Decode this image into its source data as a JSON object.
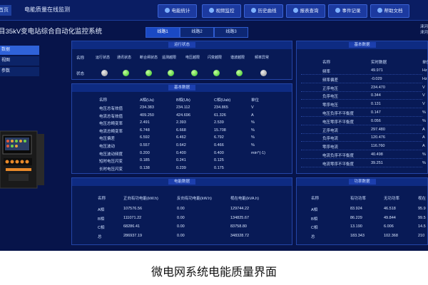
{
  "topbar": {
    "home_label": "首页",
    "system_title": "电能质量在线监测",
    "nav": [
      {
        "label": "电能统计",
        "icon": "chart-icon"
      },
      {
        "label": "视频监控",
        "icon": "video-icon"
      },
      {
        "label": "历史曲线",
        "icon": "curve-icon"
      },
      {
        "label": "报表查询",
        "icon": "report-icon"
      },
      {
        "label": "事件记录",
        "icon": "event-icon"
      },
      {
        "label": "帮助文档",
        "icon": "help-icon"
      }
    ]
  },
  "page": {
    "title": "目35kV变电站综合自动化监控系统",
    "line_tabs": [
      "线路1",
      "线路2",
      "线路3"
    ],
    "active_tab": 0,
    "user_line1": "涞河",
    "user_line2": "涞河"
  },
  "sidebar": {
    "items": [
      {
        "label": "数据",
        "active": true
      },
      {
        "label": "视图",
        "active": false
      },
      {
        "label": "参数",
        "active": false
      }
    ]
  },
  "run_status": {
    "title": "运行状态",
    "name_header": "名称",
    "row_label": "状态",
    "columns": [
      "运行状态",
      "通讯状态",
      "断合闸状态",
      "遥测越限",
      "电压越限",
      "闪变越限",
      "谐波越限",
      "频率异常"
    ],
    "states": [
      "off",
      "on",
      "on",
      "on",
      "on",
      "on",
      "on",
      "off"
    ]
  },
  "basic_data": {
    "title": "基本数据",
    "headers": [
      "名称",
      "A相(Ua)",
      "B相(Ub)",
      "C相(Uab)",
      "单位"
    ],
    "rows": [
      [
        "电压总有效值",
        "234.383",
        "234.112",
        "234.865",
        "V"
      ],
      [
        "电流总有效值",
        "409.250",
        "424.696",
        "61.326",
        "A"
      ],
      [
        "电压总畸变率",
        "2.491",
        "2.393",
        "2.539",
        "%"
      ],
      [
        "电流总畸变率",
        "6.748",
        "6.668",
        "15.708",
        "%"
      ],
      [
        "电压偏差",
        "6.592",
        "6.462",
        "6.792",
        "%"
      ],
      [
        "电压波动",
        "0.557",
        "0.642",
        "0.466",
        "%"
      ],
      [
        "电压波动频度",
        "0.200",
        "0.400",
        "0.400",
        "min^(-1)"
      ],
      [
        "短时电压闪变",
        "0.185",
        "0.241",
        "0.125",
        ""
      ],
      [
        "长时电压闪变",
        "0.138",
        "0.239",
        "0.175",
        ""
      ]
    ]
  },
  "base_data_right": {
    "title": "基本数据",
    "headers": [
      "名称",
      "实时数据",
      "单位"
    ],
    "rows": [
      [
        "频率",
        "49.971",
        "Hz"
      ],
      [
        "频率偏差",
        "-0.029",
        "Hz"
      ],
      [
        "正序电压",
        "234.470",
        "V"
      ],
      [
        "负序电压",
        "0.344",
        "V"
      ],
      [
        "零序电压",
        "0.131",
        "V"
      ],
      [
        "电压负序不平衡度",
        "0.147",
        "%"
      ],
      [
        "电压零序不平衡度",
        "0.056",
        "%"
      ],
      [
        "正序电流",
        "297.480",
        "A"
      ],
      [
        "负序电流",
        "120.476",
        "A"
      ],
      [
        "零序电流",
        "116.760",
        "A"
      ],
      [
        "电流负序不平衡度",
        "40.498",
        "%"
      ],
      [
        "电流零序不平衡度",
        "39.251",
        "%"
      ]
    ]
  },
  "energy": {
    "title": "电能数据",
    "headers": [
      "名称",
      "正向有功电能(kW.h)",
      "反向有功电能(kW.h)",
      "视在电能(kVA.h)"
    ],
    "rows": [
      [
        "A相",
        "107576.56",
        "0.00",
        "129744.22"
      ],
      [
        "B相",
        "111071.22",
        "0.00",
        "134825.67"
      ],
      [
        "C相",
        "68286.41",
        "0.00",
        "83758.80"
      ],
      [
        "总",
        "286937.19",
        "0.00",
        "348328.72"
      ]
    ]
  },
  "power": {
    "title": "功率数据",
    "headers": [
      "名称",
      "有功功率",
      "无功功率",
      "视在"
    ],
    "rows": [
      [
        "A相",
        "83.924",
        "46.518",
        "95.9"
      ],
      [
        "B相",
        "86.229",
        "49.844",
        "99.5"
      ],
      [
        "C相",
        "13.190",
        "6.006",
        "14.5"
      ],
      [
        "总",
        "183.343",
        "102.368",
        "210"
      ]
    ]
  },
  "caption": "微电网系统电能质量界面",
  "colors": {
    "background": "#07144a",
    "panel": "#081a56",
    "accent": "#2f62d8",
    "lamp_on": "#2fbf1f",
    "lamp_off": "#9a9a9a"
  }
}
